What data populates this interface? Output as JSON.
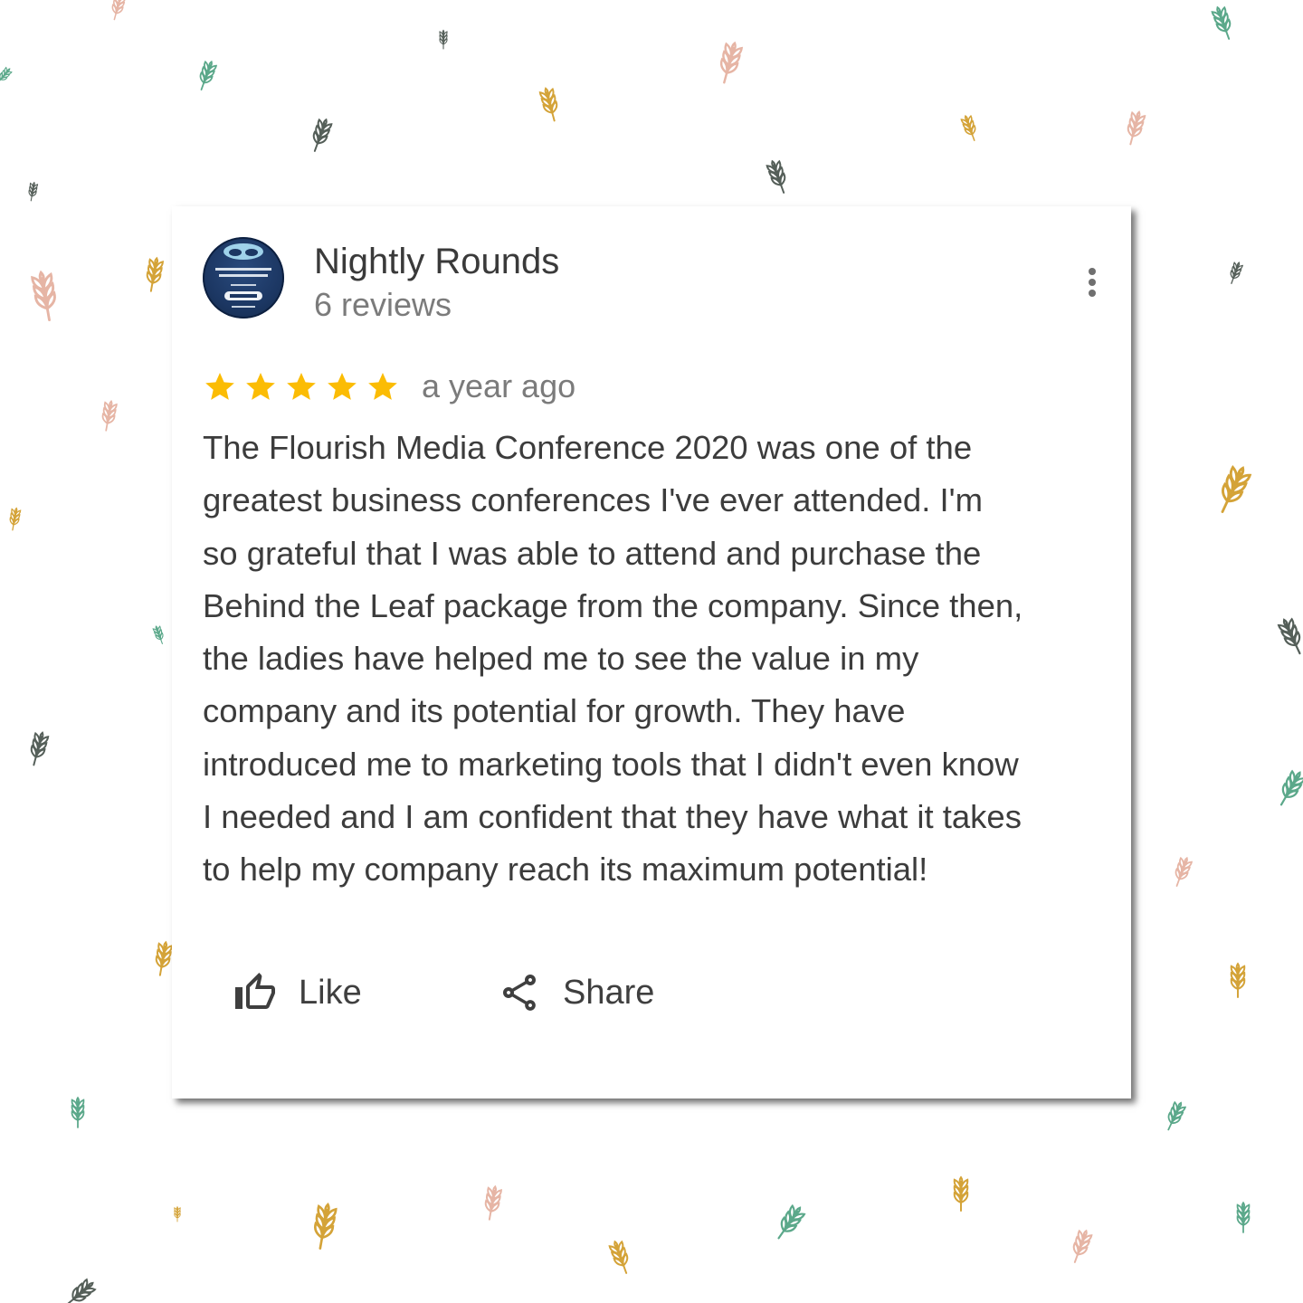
{
  "review": {
    "reviewer_name": "Nightly Rounds",
    "review_count": "6 reviews",
    "rating": 5,
    "max_rating": 5,
    "time": "a year ago",
    "text": "The Flourish Media Conference 2020 was one of the\ngreatest business conferences I've ever attended.  I'm\nso grateful that I was able to attend and purchase the\nBehind the Leaf package from the company.  Since then,\nthe ladies have helped me to see the value in my\ncompany and its potential for growth.  They have\nintroduced me to marketing tools that I didn't even know\nI needed and I am confident that they have what it takes\nto help my company reach its maximum potential!",
    "actions": {
      "like_label": "Like",
      "share_label": "Share"
    }
  },
  "icons": {
    "avatar": "nightly-rounds-logo",
    "more": "more-vert-icon",
    "star": "star-icon",
    "like": "thumb-up-outline-icon",
    "share": "share-icon",
    "background": "wheat-icon"
  },
  "colors": {
    "star": "#fbbc04",
    "card_background": "#ffffff",
    "wheat_pink": "#e6b5a5",
    "wheat_gold": "#d4a338",
    "wheat_green": "#5ba88a",
    "wheat_gray": "#555f59",
    "avatar_navy": "#1c3763"
  }
}
